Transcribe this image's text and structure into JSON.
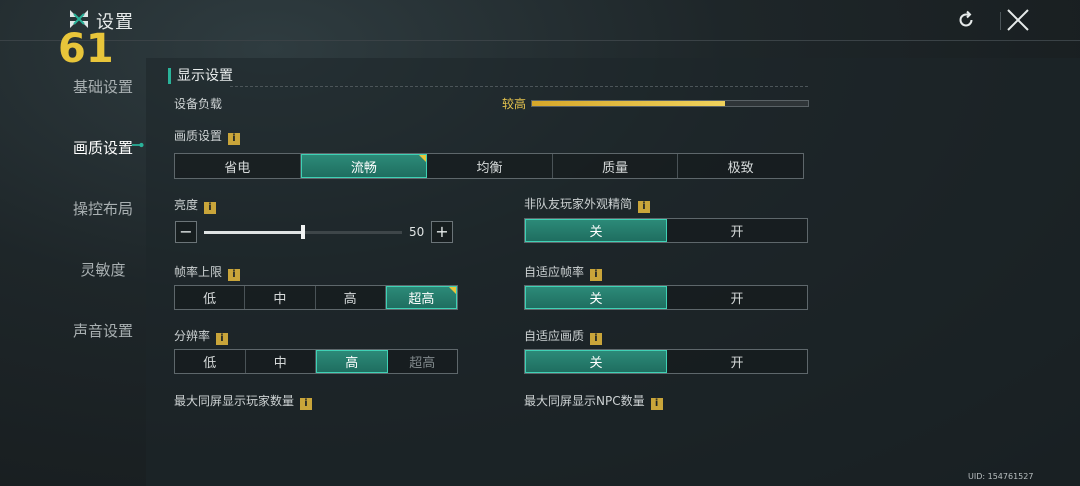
{
  "header": {
    "title": "设置",
    "fps": "61"
  },
  "sidebar": {
    "items": [
      {
        "label": "基础设置",
        "active": false
      },
      {
        "label": "画质设置",
        "active": true
      },
      {
        "label": "操控布局",
        "active": false
      },
      {
        "label": "灵敏度",
        "active": false
      },
      {
        "label": "声音设置",
        "active": false
      }
    ]
  },
  "section": {
    "title": "显示设置"
  },
  "device_load": {
    "label": "设备负载",
    "value_text": "较高",
    "fraction": 0.7,
    "color": "#e6c44e"
  },
  "quality": {
    "label": "画质设置",
    "options": [
      "省电",
      "流畅",
      "均衡",
      "质量",
      "极致"
    ],
    "selected": 1
  },
  "brightness": {
    "label": "亮度",
    "value": "50",
    "fraction": 0.5,
    "minus": "−",
    "plus": "+"
  },
  "framerate": {
    "label": "帧率上限",
    "options": [
      "低",
      "中",
      "高",
      "超高"
    ],
    "selected": 3
  },
  "resolution": {
    "label": "分辨率",
    "options": [
      "低",
      "中",
      "高",
      "超高"
    ],
    "selected": 2
  },
  "max_players": {
    "label": "最大同屏显示玩家数量"
  },
  "simplify_nonteam": {
    "label": "非队友玩家外观精简",
    "options": [
      "关",
      "开"
    ],
    "selected": 0
  },
  "adaptive_fps": {
    "label": "自适应帧率",
    "options": [
      "关",
      "开"
    ],
    "selected": 0
  },
  "adaptive_quality": {
    "label": "自适应画质",
    "options": [
      "关",
      "开"
    ],
    "selected": 0
  },
  "max_npc": {
    "label": "最大同屏显示NPC数量"
  },
  "info_glyph": "i",
  "uid": "UID: 154761527",
  "colors": {
    "accent": "#2ab39a",
    "selected_bg": "#1f6e60",
    "gold": "#e8c53a"
  }
}
